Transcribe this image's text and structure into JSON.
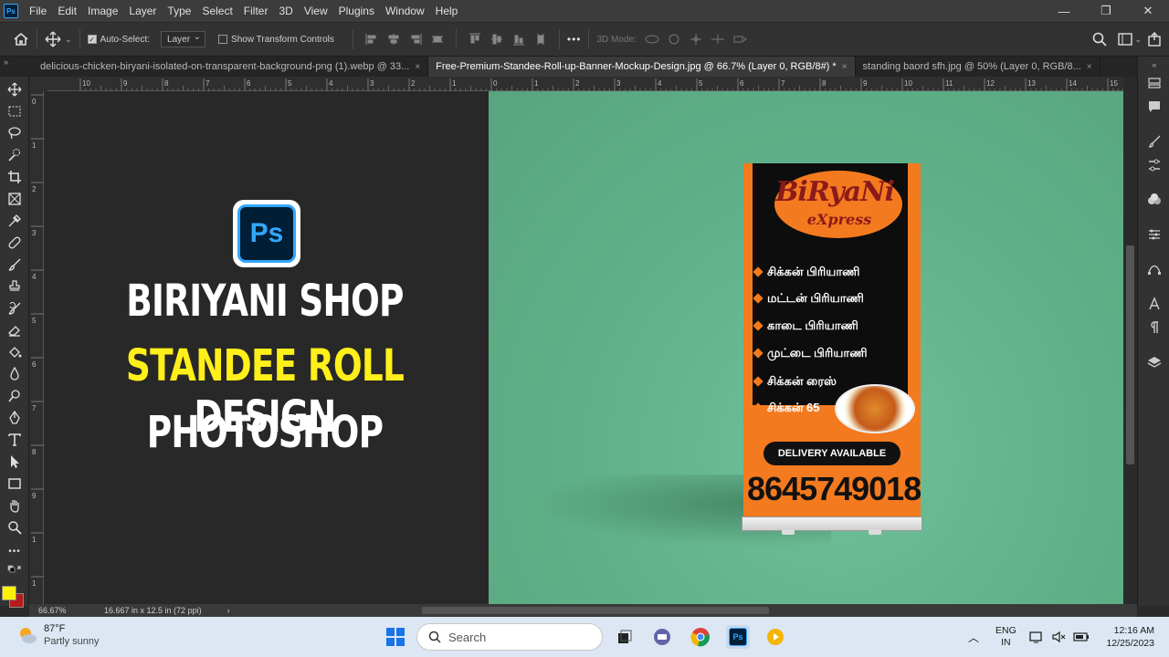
{
  "app": {
    "menus": [
      "File",
      "Edit",
      "Image",
      "Layer",
      "Type",
      "Select",
      "Filter",
      "3D",
      "View",
      "Plugins",
      "Window",
      "Help"
    ],
    "ps_logo": "Ps",
    "window_controls": {
      "minimize": "—",
      "maximize": "❐",
      "close": "✕"
    }
  },
  "options": {
    "auto_select_label": "Auto-Select:",
    "auto_select_value": "Layer",
    "show_transform_label": "Show Transform Controls",
    "mode_3d_label": "3D Mode:",
    "more": "•••"
  },
  "tabs": [
    {
      "label": "delicious-chicken-biryani-isolated-on-transparent-background-png (1).webp @ 33...",
      "active": false
    },
    {
      "label": "Free-Premium-Standee-Roll-up-Banner-Mockup-Design.jpg @ 66.7% (Layer 0, RGB/8#) *",
      "active": true
    },
    {
      "label": "standing baord sfh.jpg @ 50% (Layer 0, RGB/8...",
      "active": false
    }
  ],
  "tab_close": "×",
  "ruler": {
    "top_labels": [
      "10",
      "9",
      "8",
      "7",
      "6",
      "5",
      "4",
      "3",
      "2",
      "1",
      "0",
      "1",
      "2",
      "3",
      "4",
      "5",
      "6",
      "7",
      "8",
      "9",
      "10",
      "11",
      "12",
      "13",
      "14",
      "15"
    ],
    "left_labels": [
      "0",
      "1",
      "2",
      "3",
      "4",
      "5",
      "6",
      "7",
      "8",
      "9",
      "1",
      "1",
      "1"
    ]
  },
  "overlay": {
    "badge": "Ps",
    "line1": "BIRIYANI SHOP",
    "line2_highlight": "STANDEE ROLL",
    "line2_rest": " DESIGN",
    "line3": "PHOTOSHOP"
  },
  "banner": {
    "logo_title": "BiRyaNi",
    "logo_sub": "eXpress",
    "items": [
      "சிக்கன் பிரியாணி",
      "மட்டன் பிரியாணி",
      "காடை பிரியாணி",
      "முட்டை பிரியாணி",
      "சிக்கன் ரைஸ்",
      "சிக்கன் 65"
    ],
    "delivery": "DELIVERY AVAILABLE",
    "phone": "8645749018",
    "accent": "#f47a1f"
  },
  "status": {
    "zoom": "66.67%",
    "doc_info": "16.667 in x 12.5 in (72 ppi)",
    "arrow": "›"
  },
  "taskbar": {
    "temperature": "87°F",
    "weather": "Partly sunny",
    "search_placeholder": "Search",
    "lang_top": "ENG",
    "lang_bottom": "IN",
    "time": "12:16 AM",
    "date": "12/25/2023"
  },
  "colors": {
    "foreground": "#fff200",
    "background": "#b71c1c",
    "canvas_green": "#5fb088"
  }
}
